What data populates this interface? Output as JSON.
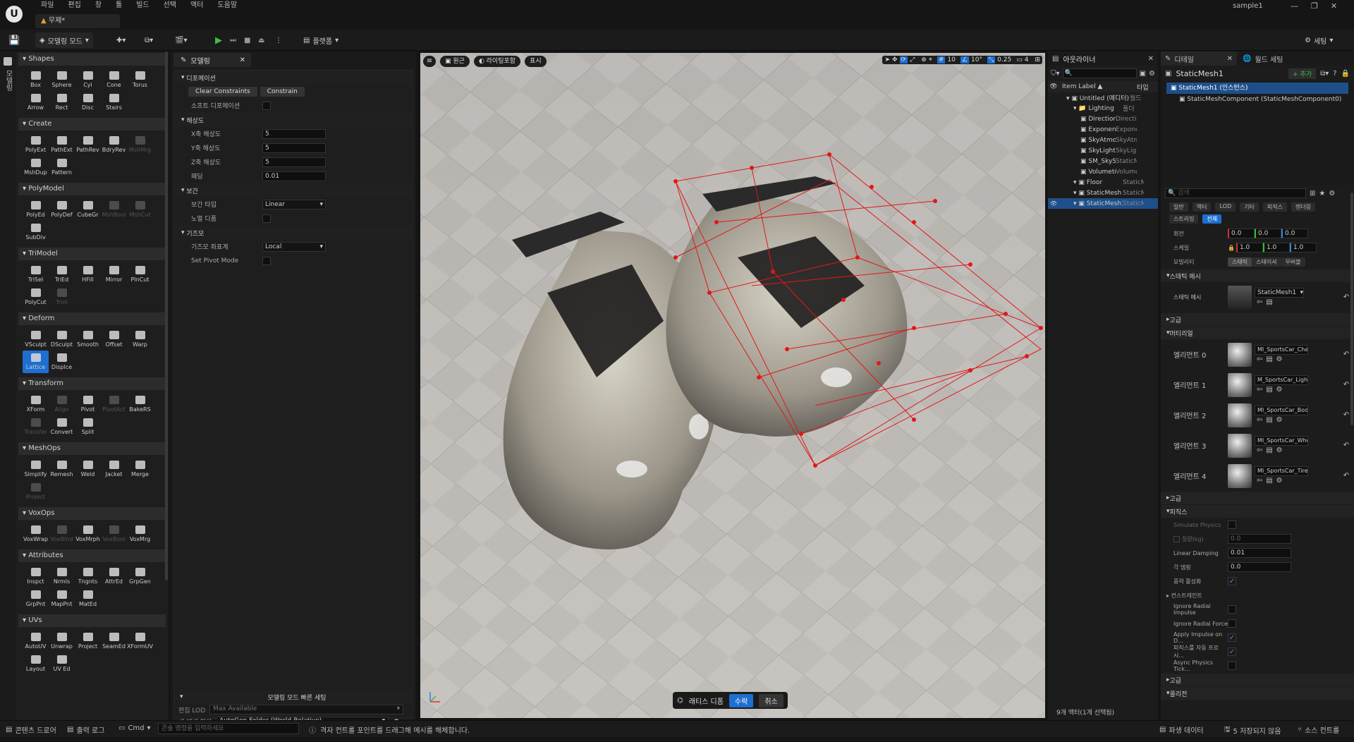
{
  "app": {
    "menus": [
      "파일",
      "편집",
      "창",
      "툴",
      "빌드",
      "선택",
      "액터",
      "도움말"
    ],
    "project": "sample1",
    "doc_tab": "무제*"
  },
  "toolbar": {
    "mode": "모델링 모드",
    "platform": "플랫폼",
    "settings": "세팅"
  },
  "left_strip": {
    "label": "모델링"
  },
  "tool_sections": [
    {
      "name": "Shapes",
      "tools": [
        {
          "l": "Box"
        },
        {
          "l": "Sphere"
        },
        {
          "l": "Cyl"
        },
        {
          "l": "Cone"
        },
        {
          "l": "Torus"
        },
        {
          "l": "Arrow"
        },
        {
          "l": "Rect"
        },
        {
          "l": "Disc"
        },
        {
          "l": "Stairs"
        }
      ]
    },
    {
      "name": "Create",
      "tools": [
        {
          "l": "PolyExt"
        },
        {
          "l": "PathExt"
        },
        {
          "l": "PathRev"
        },
        {
          "l": "BdryRev"
        },
        {
          "l": "MshMrg",
          "d": true
        },
        {
          "l": "MshDup"
        },
        {
          "l": "Pattern"
        }
      ]
    },
    {
      "name": "PolyModel",
      "tools": [
        {
          "l": "PolyEd"
        },
        {
          "l": "PolyDef"
        },
        {
          "l": "CubeGr"
        },
        {
          "l": "MshBool",
          "d": true
        },
        {
          "l": "MshCut",
          "d": true
        },
        {
          "l": "SubDiv"
        }
      ]
    },
    {
      "name": "TriModel",
      "tools": [
        {
          "l": "TriSel"
        },
        {
          "l": "TriEd"
        },
        {
          "l": "HFill"
        },
        {
          "l": "Mirror"
        },
        {
          "l": "PlnCut"
        },
        {
          "l": "PolyCut"
        },
        {
          "l": "Trim",
          "d": true
        }
      ]
    },
    {
      "name": "Deform",
      "tools": [
        {
          "l": "VSculpt"
        },
        {
          "l": "DSculpt"
        },
        {
          "l": "Smooth"
        },
        {
          "l": "Offset"
        },
        {
          "l": "Warp"
        },
        {
          "l": "Lattice",
          "a": true
        },
        {
          "l": "Displce"
        }
      ]
    },
    {
      "name": "Transform",
      "tools": [
        {
          "l": "XForm"
        },
        {
          "l": "Align",
          "d": true
        },
        {
          "l": "Pivot"
        },
        {
          "l": "PivotAct",
          "d": true
        },
        {
          "l": "BakeRS"
        },
        {
          "l": "Transfer",
          "d": true
        },
        {
          "l": "Convert"
        },
        {
          "l": "Split"
        }
      ]
    },
    {
      "name": "MeshOps",
      "tools": [
        {
          "l": "Simplify"
        },
        {
          "l": "Remesh"
        },
        {
          "l": "Weld"
        },
        {
          "l": "Jacket"
        },
        {
          "l": "Merge"
        },
        {
          "l": "Project",
          "d": true
        }
      ]
    },
    {
      "name": "VoxOps",
      "tools": [
        {
          "l": "VoxWrap"
        },
        {
          "l": "VoxBlnd",
          "d": true
        },
        {
          "l": "VoxMrph"
        },
        {
          "l": "VoxBool",
          "d": true
        },
        {
          "l": "VoxMrg"
        }
      ]
    },
    {
      "name": "Attributes",
      "tools": [
        {
          "l": "Inspct"
        },
        {
          "l": "Nrmls"
        },
        {
          "l": "Tngnts"
        },
        {
          "l": "AttrEd"
        },
        {
          "l": "GrpGen"
        },
        {
          "l": "GrpPnt"
        },
        {
          "l": "MapPnt"
        },
        {
          "l": "MatEd"
        }
      ]
    },
    {
      "name": "UVs",
      "tools": [
        {
          "l": "AutoUV"
        },
        {
          "l": "Unwrap"
        },
        {
          "l": "Project"
        },
        {
          "l": "SeamEd"
        },
        {
          "l": "XFormUV"
        },
        {
          "l": "Layout"
        },
        {
          "l": "UV Ed"
        }
      ]
    }
  ],
  "props": {
    "tab": "모델링",
    "deform_hdr": "디포메이션",
    "clear_btn": "Clear Constraints",
    "constrain_btn": "Constrain",
    "soft_deform": "소프트 디포메이션",
    "res_hdr": "해상도",
    "x_res": "X축 해상도",
    "y_res": "Y축 해상도",
    "z_res": "Z축 해상도",
    "padding": "패딩",
    "x_val": "5",
    "y_val": "5",
    "z_val": "5",
    "pad_val": "0.01",
    "interp_hdr": "보간",
    "interp_type": "보간 타입",
    "interp_val": "Linear",
    "normal": "노멀 디폼",
    "gizmo_hdr": "기즈모",
    "gizmo_coord": "기즈모 좌표계",
    "gizmo_val": "Local",
    "pivot": "Set Pivot Mode",
    "quick_hdr": "모델링 모드 빠른 세팅",
    "lod_label": "편집 LOD",
    "lod_val": "Max Available",
    "asset_label": "새 에셋 위치",
    "asset_val": "AutoGen Folder (World-Relative)"
  },
  "viewport": {
    "perspective": "원근",
    "lighting": "라이팅포함",
    "show": "표시",
    "grid": "10",
    "angle": "10°",
    "scale": "0.25",
    "cam": "4",
    "accept_title": "래티스 디폼",
    "accept": "수락",
    "cancel": "취소"
  },
  "outliner": {
    "title": "아웃라이너",
    "col_label": "Item Label ▲",
    "col_type": "타입",
    "rows": [
      {
        "n": "Untitled (에디터)",
        "t": "월드",
        "ind": 1
      },
      {
        "n": "Lighting",
        "t": "폴더",
        "ind": 2
      },
      {
        "n": "DirectionalLight",
        "t": "Direction",
        "ind": 3
      },
      {
        "n": "ExponentialHeightFog",
        "t": "Exponen",
        "ind": 3
      },
      {
        "n": "SkyAtmosphere",
        "t": "SkyAtm",
        "ind": 3
      },
      {
        "n": "SkyLight",
        "t": "SkyLigh",
        "ind": 3
      },
      {
        "n": "SM_SkySphere",
        "t": "StaticM",
        "ind": 3
      },
      {
        "n": "VolumetricCloud",
        "t": "Volumet",
        "ind": 3
      },
      {
        "n": "Floor",
        "t": "StaticM",
        "ind": 2
      },
      {
        "n": "StaticMesh",
        "t": "StaticM",
        "ind": 2
      },
      {
        "n": "StaticMesh1",
        "t": "StaticM",
        "ind": 2,
        "sel": true
      }
    ],
    "footer": "9개 액터(1개 선택됨)"
  },
  "details": {
    "tab1": "디테일",
    "tab2": "월드 세팅",
    "name": "StaticMesh1",
    "add": "+ 추가",
    "comp1": "StaticMesh1 (인스턴스)",
    "comp2": "StaticMeshComponent (StaticMeshComponent0)",
    "search": "검색",
    "filters": [
      "일반",
      "액터",
      "LOD",
      "기타",
      "피직스",
      "렌더링",
      "스트리밍",
      "전체"
    ],
    "rot_label": "회전",
    "rot": [
      "0.0",
      "0.0",
      "0.0"
    ],
    "scale_label": "스케일",
    "scale": [
      "1.0",
      "1.0",
      "1.0"
    ],
    "mobility": "모빌리티",
    "mob_opts": [
      "스태틱",
      "스테이셔",
      "무버블"
    ],
    "sm_hdr": "스태틱 메시",
    "sm_label": "스태틱 메시",
    "sm_val": "StaticMesh1",
    "adv": "고급",
    "mat_hdr": "머티리얼",
    "mats": [
      {
        "l": "엘리먼트 0",
        "v": "MI_SportsCar_Chassis"
      },
      {
        "l": "엘리먼트 1",
        "v": "M_SportsCar_Lights"
      },
      {
        "l": "엘리먼트 2",
        "v": "MI_SportsCar_Body"
      },
      {
        "l": "엘리먼트 3",
        "v": "MI_SportsCar_Wheels"
      },
      {
        "l": "엘리먼트 4",
        "v": "MI_SportsCar_Tire"
      }
    ],
    "phys_hdr": "피직스",
    "sim": "Simulate Physics",
    "mass": "질량(kg)",
    "mass_val": "0.0",
    "lin_damp": "Linear Damping",
    "lin_val": "0.01",
    "ang_damp": "각 댐핑",
    "ang_val": "0.0",
    "gravity": "중력 활성화",
    "constraints": "컨스트레인트",
    "irad": "Ignore Radial Impulse",
    "irforce": "Ignore Radial Force",
    "apply": "Apply Impulse on D...",
    "auto": "피직스를 자동 프로시...",
    "async": "Async Physics Tick...",
    "adv2": "고급",
    "collision": "콜리전"
  },
  "status": {
    "content": "콘텐츠 드로어",
    "output": "출력 로그",
    "cmd": "Cmd",
    "console": "콘솔 명령을 입력하세요",
    "hint": "격자 컨트롤 포인트를 드래그해 메시를 해체합니다.",
    "derived": "파생 데이터",
    "unsaved": "5 저장되지 않음",
    "source": "소스 컨트롤"
  }
}
